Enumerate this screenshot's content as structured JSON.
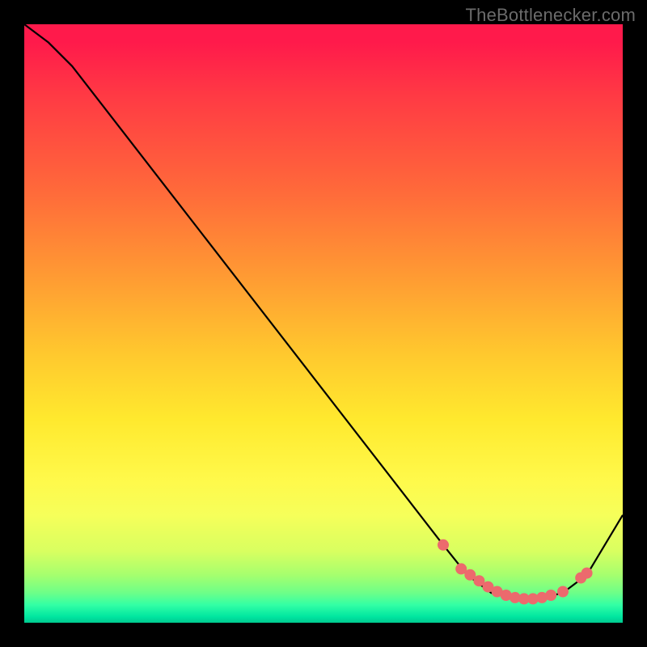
{
  "attribution": "TheBottlenecker.com",
  "chart_data": {
    "type": "line",
    "title": "",
    "xlabel": "",
    "ylabel": "",
    "xlim": [
      0,
      100
    ],
    "ylim": [
      0,
      100
    ],
    "series": [
      {
        "name": "curve",
        "x": [
          0,
          4,
          8,
          70,
          74,
          78,
          82,
          86,
          90,
          94,
          100
        ],
        "y": [
          100,
          97,
          93,
          13,
          8,
          5,
          4,
          4,
          5,
          8,
          18
        ]
      }
    ],
    "markers": {
      "name": "highlight-points",
      "x": [
        70,
        73,
        74.5,
        76,
        77.5,
        79,
        80.5,
        82,
        83.5,
        85,
        86.5,
        88,
        90,
        93,
        94
      ],
      "y": [
        13,
        9,
        8,
        7,
        6,
        5.2,
        4.6,
        4.2,
        4,
        4,
        4.2,
        4.6,
        5.2,
        7.5,
        8.3
      ]
    },
    "colors": {
      "curve": "#000000",
      "marker_fill": "#ec6a6d",
      "marker_stroke": "#ec6a6d",
      "gradient_top": "#ff1a4b",
      "gradient_bottom": "#00c98f"
    }
  }
}
